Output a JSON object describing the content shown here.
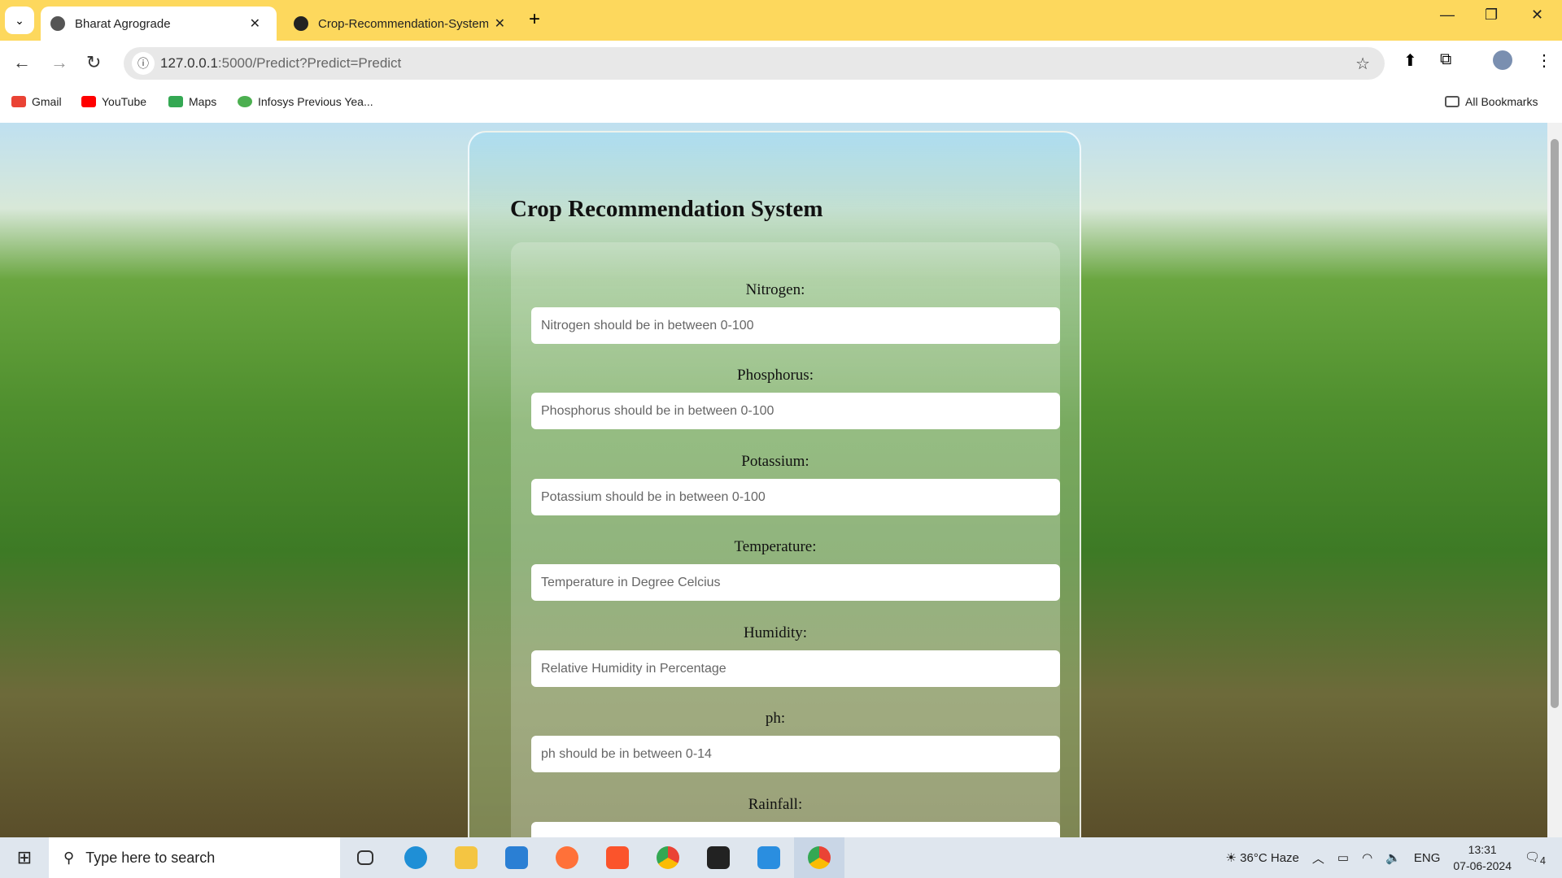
{
  "browser": {
    "tabs": [
      {
        "label": "Bharat Agrograde",
        "active": true,
        "icon": "globe-icon"
      },
      {
        "label": "Crop-Recommendation-System",
        "active": false,
        "icon": "github-icon"
      }
    ],
    "url_host": "127.0.0.1",
    "url_path": ":5000/Predict?Predict=Predict",
    "bookmarks": [
      {
        "label": "Gmail",
        "color": "#ea4335"
      },
      {
        "label": "YouTube",
        "color": "#ff0000"
      },
      {
        "label": "Maps",
        "color": "#34a853"
      },
      {
        "label": "Infosys Previous Yea...",
        "color": "#4caf50"
      }
    ],
    "all_bookmarks": "All Bookmarks"
  },
  "page": {
    "title": "Crop Recommendation System",
    "fields": [
      {
        "label": "Nitrogen:",
        "placeholder": "Nitrogen should be in between 0-100"
      },
      {
        "label": "Phosphorus:",
        "placeholder": "Phosphorus should be in between 0-100"
      },
      {
        "label": "Potassium:",
        "placeholder": "Potassium should be in between 0-100"
      },
      {
        "label": "Temperature:",
        "placeholder": "Temperature in Degree Celcius"
      },
      {
        "label": "Humidity:",
        "placeholder": "Relative Humidity in Percentage"
      },
      {
        "label": "ph:",
        "placeholder": "ph should be in between 0-14"
      },
      {
        "label": "Rainfall:",
        "placeholder": ""
      }
    ]
  },
  "taskbar": {
    "search_placeholder": "Type here to search",
    "weather": "36°C  Haze",
    "lang": "ENG",
    "time": "13:31",
    "date": "07-06-2024",
    "notifications": "4"
  }
}
